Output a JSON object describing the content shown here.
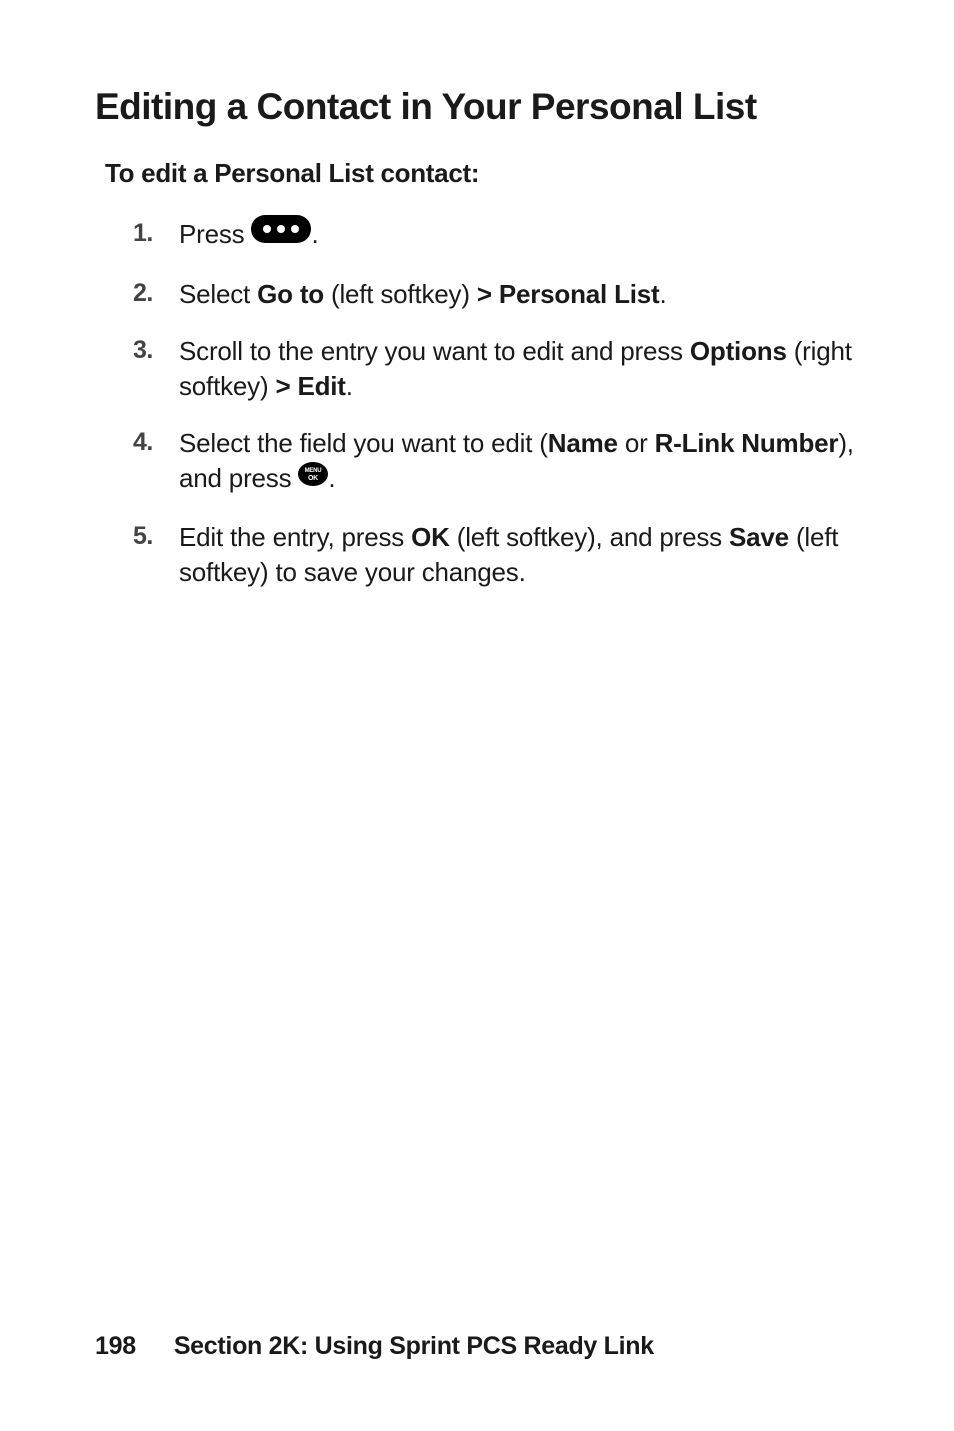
{
  "heading": "Editing a Contact in Your Personal List",
  "subheading": "To edit a Personal List contact:",
  "steps": [
    {
      "num": "1.",
      "pre": "Press ",
      "post": "."
    },
    {
      "num": "2.",
      "t1": "Select ",
      "b1": "Go to",
      "t2": " (left softkey) ",
      "b2": "> Personal List",
      "t3": "."
    },
    {
      "num": "3.",
      "t1": "Scroll to the entry you want to edit and press ",
      "b1": "Options",
      "t2": " (right softkey) ",
      "b2": "> Edit",
      "t3": "."
    },
    {
      "num": "4.",
      "t1": "Select the field you want to edit (",
      "b1": "Name",
      "t2": " or ",
      "b2": "R-Link Number",
      "t3": "), and press ",
      "post": "."
    },
    {
      "num": "5.",
      "t1": "Edit the entry, press ",
      "b1": "OK",
      "t2": " (left softkey), and press ",
      "b2": "Save",
      "t3": " (left softkey) to save your changes."
    }
  ],
  "footer": {
    "page": "198",
    "section": "Section 2K: Using Sprint PCS Ready Link"
  },
  "icons": {
    "pill": "ready-link-button-icon",
    "menu": "menu-ok-button-icon"
  }
}
